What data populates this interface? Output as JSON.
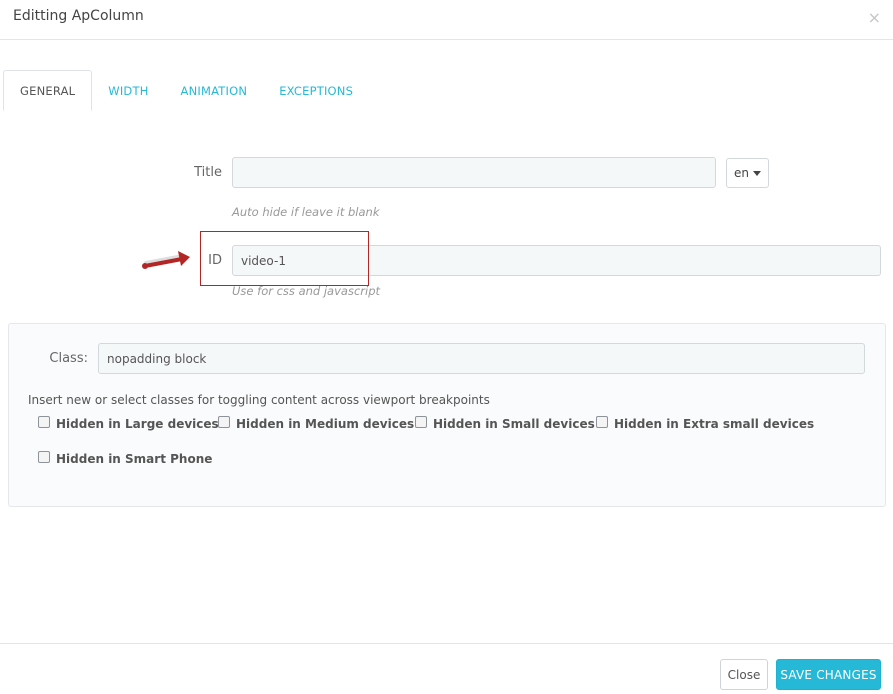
{
  "modal": {
    "title": "Editting ApColumn",
    "close_glyph": "×"
  },
  "tabs": [
    {
      "label": "GENERAL",
      "active": true
    },
    {
      "label": "WIDTH",
      "active": false
    },
    {
      "label": "ANIMATION",
      "active": false
    },
    {
      "label": "EXCEPTIONS",
      "active": false
    }
  ],
  "form": {
    "title_label": "Title",
    "title_value": "",
    "title_help": "Auto hide if leave it blank",
    "lang": "en",
    "id_label": "ID",
    "id_value": "video-1",
    "id_help": "Use for css and javascript",
    "class_label": "Class:",
    "class_value": "nopadding block",
    "class_help": "Insert new or select classes for toggling content across viewport breakpoints"
  },
  "checkboxes": [
    {
      "label": "Hidden in Large devices",
      "checked": false
    },
    {
      "label": "Hidden in Medium devices",
      "checked": false
    },
    {
      "label": "Hidden in Small devices",
      "checked": false
    },
    {
      "label": "Hidden in Extra small devices",
      "checked": false
    },
    {
      "label": "Hidden in Smart Phone",
      "checked": false
    }
  ],
  "footer": {
    "close_label": "Close",
    "save_label": "SAVE CHANGES"
  },
  "colors": {
    "accent": "#25b9d7",
    "highlight": "#b32626"
  },
  "icons": {
    "close": "close-icon",
    "caret": "caret-down-icon",
    "arrow": "annotation-arrow-icon"
  }
}
